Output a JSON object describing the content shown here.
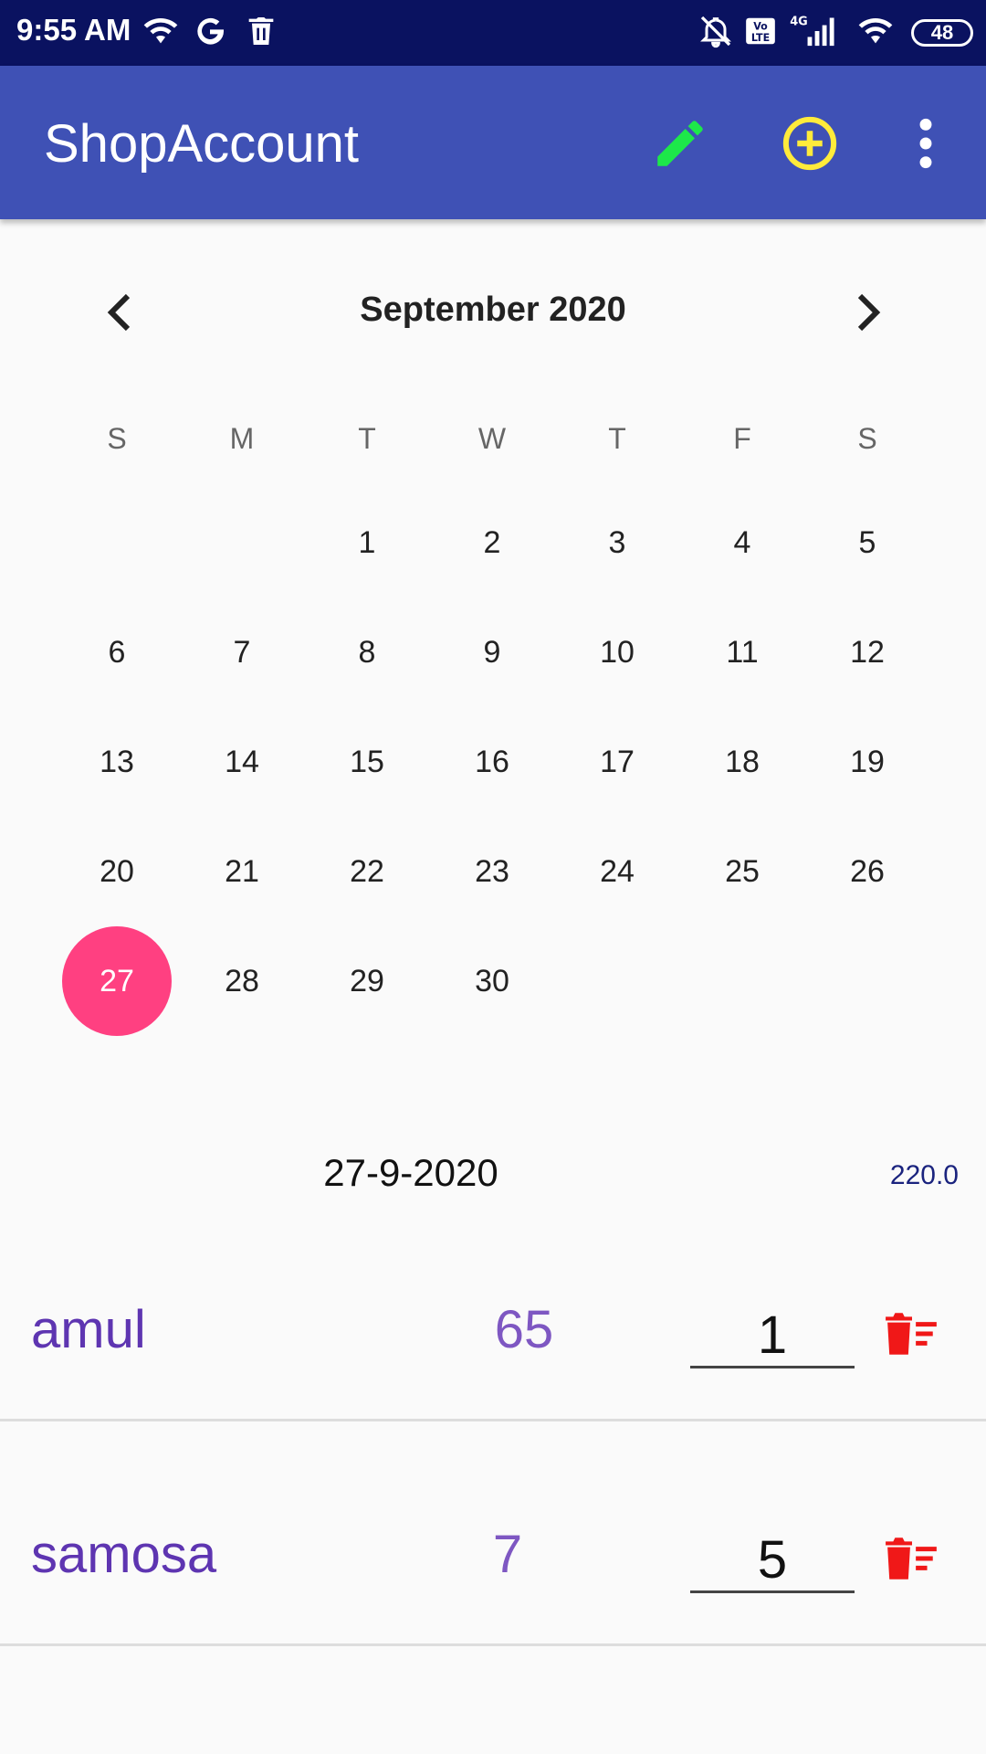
{
  "status_bar": {
    "time": "9:55 AM",
    "battery": "48",
    "icons": [
      "wifi-icon",
      "google-icon",
      "trash-icon",
      "mute-icon",
      "volte-icon",
      "signal-4g-icon",
      "wifi-icon",
      "battery-icon"
    ]
  },
  "app_bar": {
    "title": "ShopAccount",
    "edit_icon": "pencil-icon",
    "add_icon": "add-circle-icon",
    "menu_icon": "more-vert-icon",
    "colors": {
      "background": "#3f51b5",
      "edit": "#1de84a",
      "add": "#ffeb3b"
    }
  },
  "calendar": {
    "month_label": "September 2020",
    "prev_icon": "chevron-left-icon",
    "next_icon": "chevron-right-icon",
    "weekdays": [
      "S",
      "M",
      "T",
      "W",
      "T",
      "F",
      "S"
    ],
    "weeks": [
      [
        "",
        "",
        "1",
        "2",
        "3",
        "4",
        "5"
      ],
      [
        "6",
        "7",
        "8",
        "9",
        "10",
        "11",
        "12"
      ],
      [
        "13",
        "14",
        "15",
        "16",
        "17",
        "18",
        "19"
      ],
      [
        "20",
        "21",
        "22",
        "23",
        "24",
        "25",
        "26"
      ],
      [
        "27",
        "28",
        "29",
        "30",
        "",
        "",
        ""
      ]
    ],
    "selected_day": "27",
    "selected_color": "#ff4081"
  },
  "summary": {
    "date": "27-9-2020",
    "total": "220.0"
  },
  "items": [
    {
      "name": "amul",
      "price": "65",
      "qty": "1"
    },
    {
      "name": "samosa",
      "price": "7",
      "qty": "5"
    }
  ],
  "delete_icon": "delete-sweep-icon"
}
